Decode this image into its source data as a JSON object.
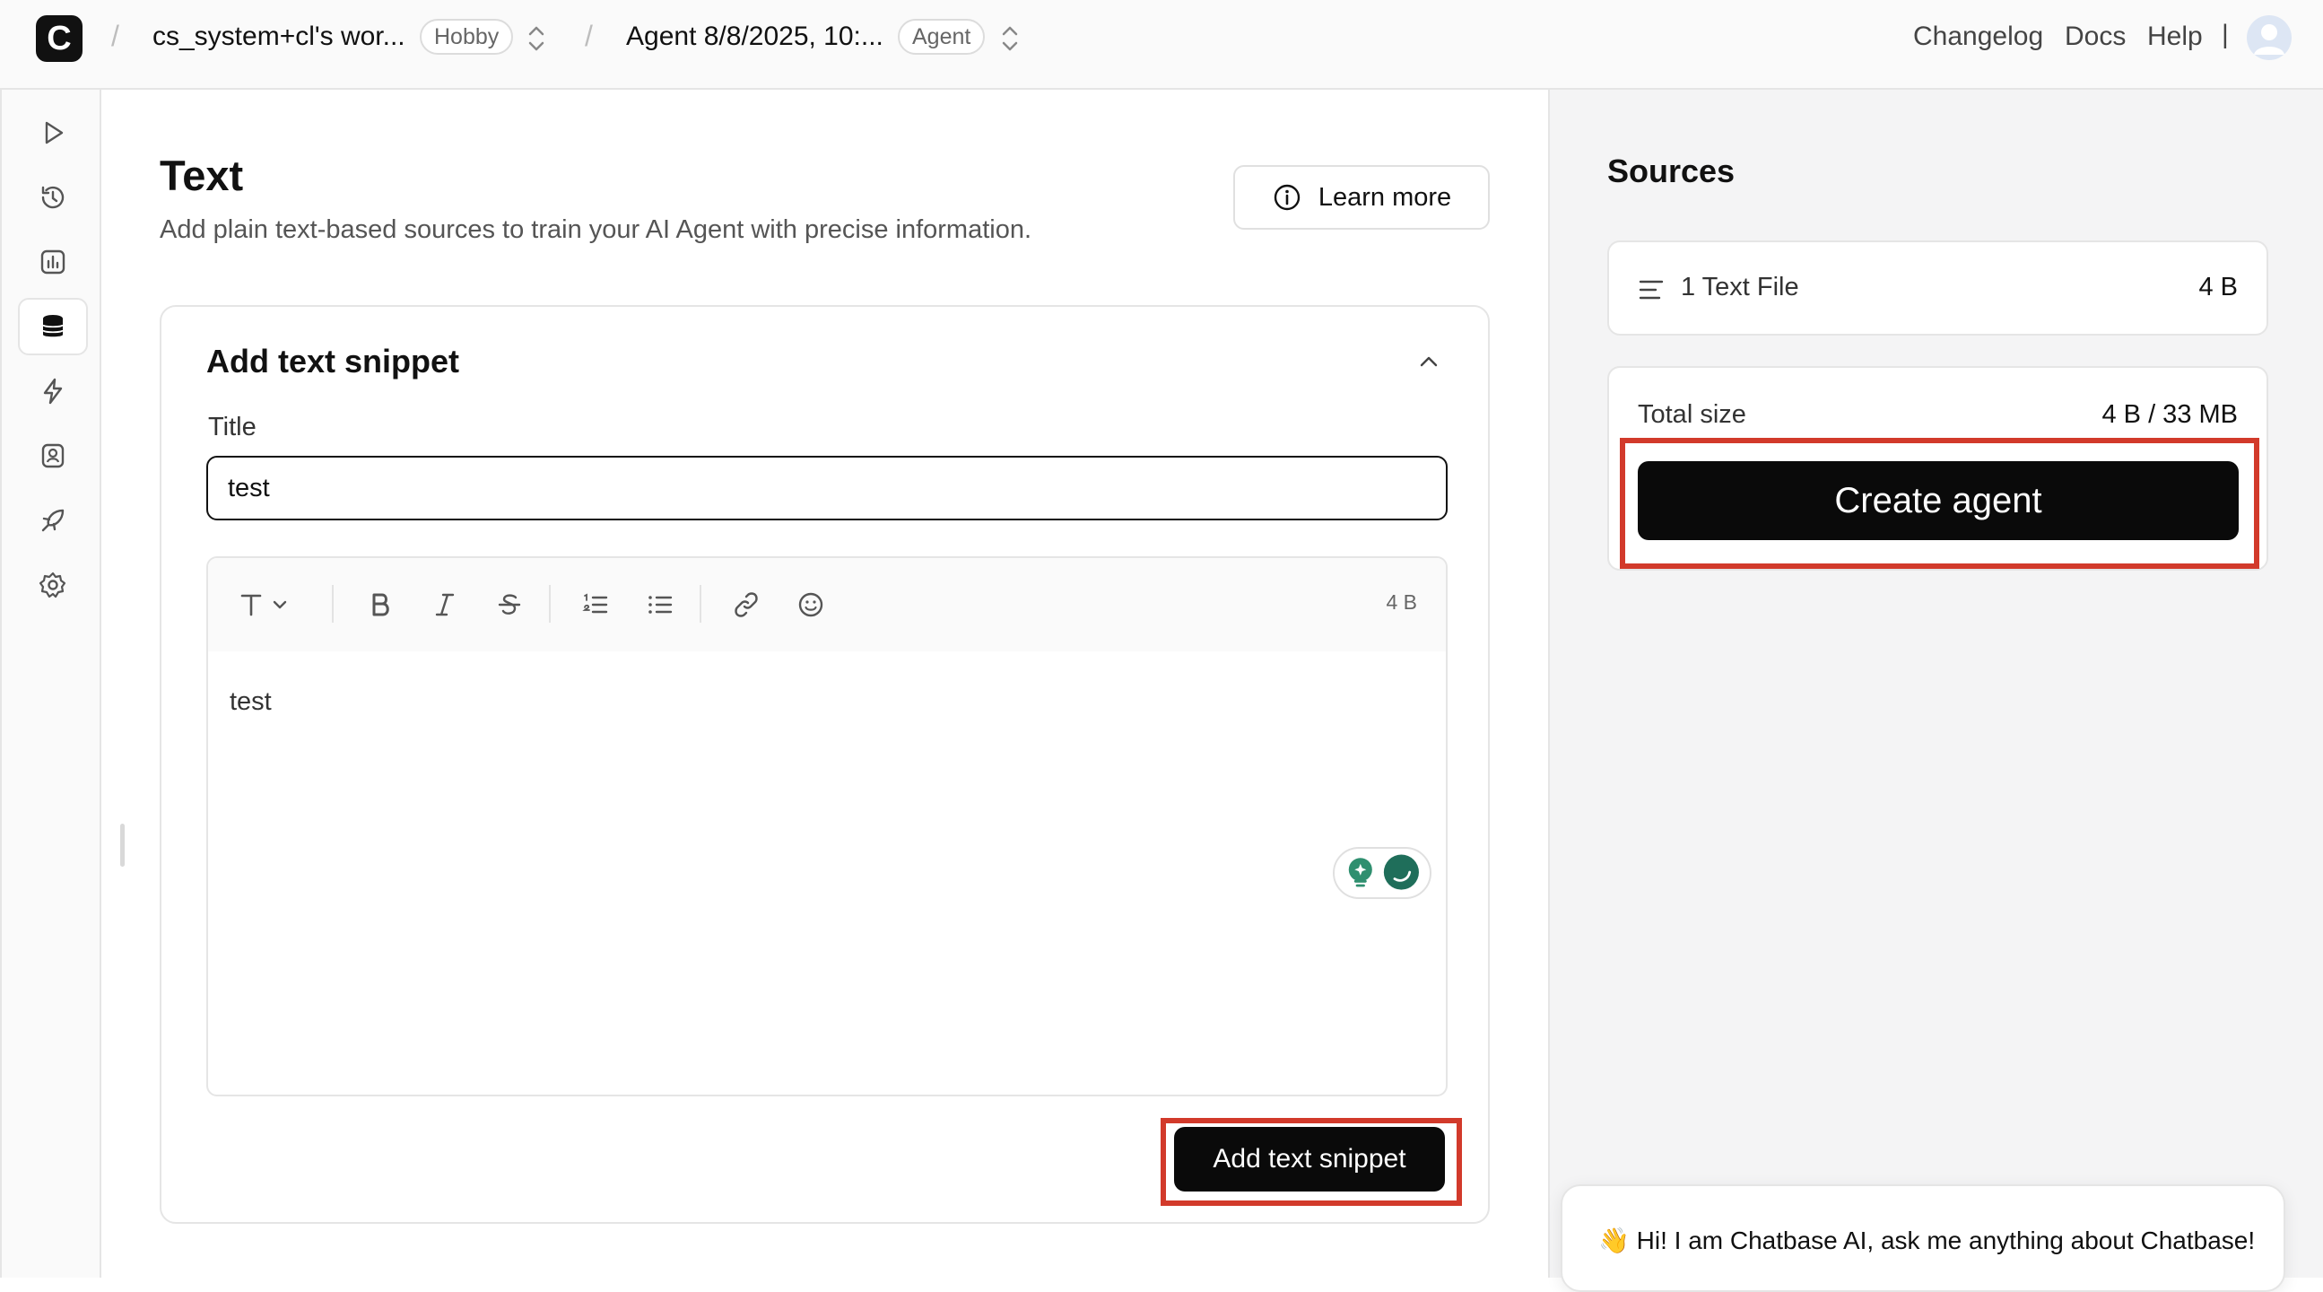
{
  "topbar": {
    "logo_letter": "C",
    "workspace": "cs_system+cl's wor...",
    "workspace_badge": "Hobby",
    "agent": "Agent 8/8/2025, 10:...",
    "agent_badge": "Agent",
    "separator": "/",
    "links": {
      "changelog": "Changelog",
      "docs": "Docs",
      "help": "Help"
    },
    "divider": "|"
  },
  "sidebar": {
    "items": [
      {
        "name": "playground",
        "icon": "play-icon"
      },
      {
        "name": "activity",
        "icon": "history-icon"
      },
      {
        "name": "analytics",
        "icon": "chart-icon"
      },
      {
        "name": "sources",
        "icon": "database-icon",
        "active": true
      },
      {
        "name": "actions",
        "icon": "bolt-icon"
      },
      {
        "name": "contacts",
        "icon": "contact-icon"
      },
      {
        "name": "deploy",
        "icon": "rocket-icon"
      },
      {
        "name": "settings",
        "icon": "gear-icon"
      }
    ]
  },
  "main": {
    "title": "Text",
    "subtitle": "Add plain text-based sources to train your AI Agent with precise information.",
    "learn_more": "Learn more",
    "snippet": {
      "heading": "Add text snippet",
      "title_label": "Title",
      "title_value": "test",
      "size": "4 B",
      "body": "test",
      "submit": "Add text snippet"
    }
  },
  "sources": {
    "title": "Sources",
    "file_label": "1 Text File",
    "file_size": "4 B",
    "total_label": "Total size",
    "total_value": "4 B / 33 MB",
    "create_button": "Create agent"
  },
  "chat": {
    "message": "👋 Hi! I am Chatbase AI, ask me anything about Chatbase!"
  },
  "colors": {
    "highlight": "#d23a2b",
    "primary_button": "#0a0a0a",
    "assistant_green": "#2f8f6f"
  }
}
